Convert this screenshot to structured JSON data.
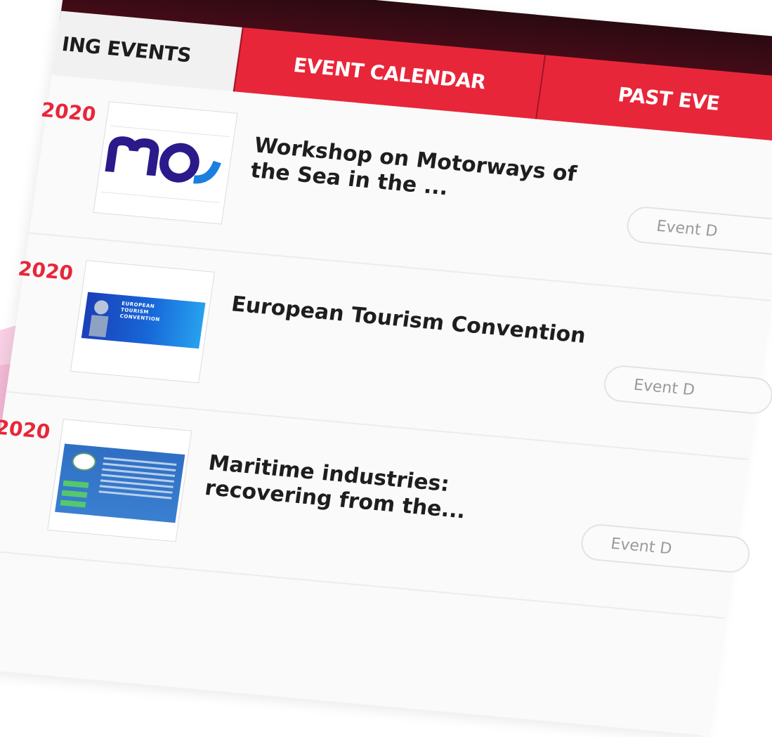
{
  "tabs": [
    {
      "label": "ING EVENTS",
      "active": true
    },
    {
      "label": "EVENT CALENDAR",
      "active": false
    },
    {
      "label": "PAST EVE",
      "active": false
    }
  ],
  "events": [
    {
      "year": "2020",
      "title": "Workshop on Motorways of the Sea in the ...",
      "button_label": "Event D",
      "thumbnail": "mos-logo"
    },
    {
      "year": "2020",
      "title": "European Tourism Convention",
      "button_label": "Event D",
      "thumbnail": "european-tourism-convention-banner",
      "thumbnail_text": [
        "EUROPEAN",
        "TOURISM",
        "CONVENTION"
      ]
    },
    {
      "year": "2020",
      "title": "Maritime industries: recovering from the...",
      "button_label": "Event D",
      "thumbnail": "maritime-industries-banner"
    }
  ],
  "colors": {
    "accent_red": "#e8263a",
    "topbar_dark": "#2a0a12",
    "background_pink": "#f7c8e0"
  }
}
